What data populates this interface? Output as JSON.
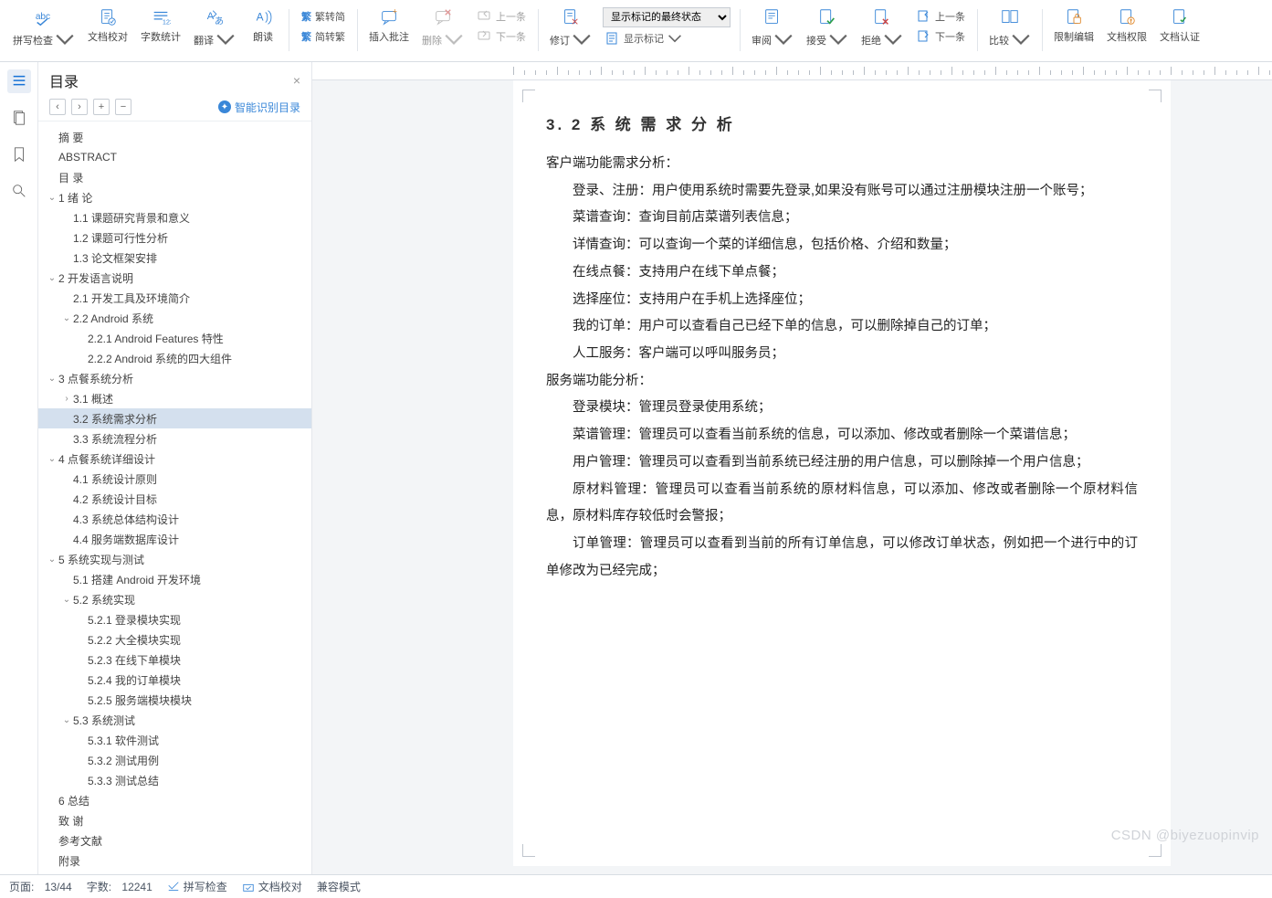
{
  "toolbar": {
    "spellcheck": "拼写检查",
    "proofread": "文档校对",
    "wordcount": "字数统计",
    "translate": "翻译",
    "read": "朗读",
    "fanjian_top": "繁转简",
    "fanjian_bot": "简转繁",
    "fanjian_pre1": "繁",
    "fanjian_pre2": "繁",
    "insert_comment": "插入批注",
    "delete": "删除",
    "prev_comment": "上一条",
    "next_comment": "下一条",
    "revise": "修订",
    "show_markup_label": "显示标记",
    "markup_select": "显示标记的最终状态",
    "review": "审阅",
    "accept": "接受",
    "reject": "拒绝",
    "rev_prev": "上一条",
    "rev_next": "下一条",
    "compare": "比较",
    "restrict": "限制编辑",
    "permission": "文档权限",
    "certify": "文档认证"
  },
  "panel": {
    "title": "目录",
    "close": "×",
    "smart": "智能识别目录",
    "btn_collapse": "‹",
    "btn_expand": "›",
    "btn_add": "+",
    "btn_remove": "−"
  },
  "outline": [
    {
      "d": 1,
      "tw": "",
      "t": "摘  要"
    },
    {
      "d": 1,
      "tw": "",
      "t": "ABSTRACT"
    },
    {
      "d": 1,
      "tw": "",
      "t": "目 录"
    },
    {
      "d": 1,
      "tw": "v",
      "t": "1 绪 论"
    },
    {
      "d": 2,
      "tw": "",
      "t": "1.1 课题研究背景和意义"
    },
    {
      "d": 2,
      "tw": "",
      "t": "1.2 课题可行性分析"
    },
    {
      "d": 2,
      "tw": "",
      "t": "1.3 论文框架安排"
    },
    {
      "d": 1,
      "tw": "v",
      "t": "2 开发语言说明"
    },
    {
      "d": 2,
      "tw": "",
      "t": "2.1 开发工具及环境简介"
    },
    {
      "d": 2,
      "tw": "v",
      "t": "2.2 Android 系统"
    },
    {
      "d": 3,
      "tw": "",
      "t": "2.2.1 Android Features 特性"
    },
    {
      "d": 3,
      "tw": "",
      "t": "2.2.2 Android 系统的四大组件"
    },
    {
      "d": 1,
      "tw": "v",
      "t": "3 点餐系统分析"
    },
    {
      "d": 2,
      "tw": ">",
      "t": "3.1 概述"
    },
    {
      "d": 2,
      "tw": "",
      "t": "3.2 系统需求分析",
      "active": true
    },
    {
      "d": 2,
      "tw": "",
      "t": "3.3 系统流程分析"
    },
    {
      "d": 1,
      "tw": "v",
      "t": "4 点餐系统详细设计"
    },
    {
      "d": 2,
      "tw": "",
      "t": "4.1 系统设计原则"
    },
    {
      "d": 2,
      "tw": "",
      "t": "4.2 系统设计目标"
    },
    {
      "d": 2,
      "tw": "",
      "t": "4.3 系统总体结构设计"
    },
    {
      "d": 2,
      "tw": "",
      "t": "4.4 服务端数据库设计"
    },
    {
      "d": 1,
      "tw": "v",
      "t": "5 系统实现与测试"
    },
    {
      "d": 2,
      "tw": "",
      "t": "5.1 搭建 Android 开发环境"
    },
    {
      "d": 2,
      "tw": "v",
      "t": "5.2 系统实现"
    },
    {
      "d": 3,
      "tw": "",
      "t": "5.2.1 登录模块实现"
    },
    {
      "d": 3,
      "tw": "",
      "t": "5.2.2 大全模块实现"
    },
    {
      "d": 3,
      "tw": "",
      "t": "5.2.3 在线下单模块"
    },
    {
      "d": 3,
      "tw": "",
      "t": "5.2.4 我的订单模块"
    },
    {
      "d": 3,
      "tw": "",
      "t": "5.2.5 服务端模块模块"
    },
    {
      "d": 2,
      "tw": "v",
      "t": "5.3 系统测试"
    },
    {
      "d": 3,
      "tw": "",
      "t": "5.3.1 软件测试"
    },
    {
      "d": 3,
      "tw": "",
      "t": "5.3.2 测试用例"
    },
    {
      "d": 3,
      "tw": "",
      "t": "5.3.3 测试总结"
    },
    {
      "d": 1,
      "tw": "",
      "t": "6 总结"
    },
    {
      "d": 1,
      "tw": "",
      "t": "致 谢"
    },
    {
      "d": 1,
      "tw": "",
      "t": "参考文献"
    },
    {
      "d": 1,
      "tw": "",
      "t": "附录"
    }
  ],
  "doc": {
    "heading": "3. 2 系 统 需 求 分 析",
    "paras": [
      {
        "ind": false,
        "t": "客户端功能需求分析："
      },
      {
        "ind": true,
        "t": "登录、注册：用户使用系统时需要先登录,如果没有账号可以通过注册模块注册一个账号；"
      },
      {
        "ind": true,
        "t": "菜谱查询：查询目前店菜谱列表信息；"
      },
      {
        "ind": true,
        "t": "详情查询：可以查询一个菜的详细信息，包括价格、介绍和数量；"
      },
      {
        "ind": true,
        "t": "在线点餐：支持用户在线下单点餐；"
      },
      {
        "ind": true,
        "t": "选择座位：支持用户在手机上选择座位；"
      },
      {
        "ind": true,
        "t": "我的订单：用户可以查看自己已经下单的信息，可以删除掉自己的订单；"
      },
      {
        "ind": true,
        "t": "人工服务：客户端可以呼叫服务员；"
      },
      {
        "ind": false,
        "t": "服务端功能分析："
      },
      {
        "ind": true,
        "t": "登录模块：管理员登录使用系统；"
      },
      {
        "ind": true,
        "t": "菜谱管理：管理员可以查看当前系统的信息，可以添加、修改或者删除一个菜谱信息；"
      },
      {
        "ind": true,
        "t": "用户管理：管理员可以查看到当前系统已经注册的用户信息，可以删除掉一个用户信息；"
      },
      {
        "ind": true,
        "t": "原材料管理：管理员可以查看当前系统的原材料信息，可以添加、修改或者删除一个原材料信息，原材料库存较低时会警报；"
      },
      {
        "ind": true,
        "t": "订单管理：管理员可以查看到当前的所有订单信息，可以修改订单状态，例如把一个进行中的订单修改为已经完成；"
      }
    ]
  },
  "status": {
    "page_label": "页面:",
    "page_val": "13/44",
    "words_label": "字数:",
    "words_val": "12241",
    "spell": "拼写检查",
    "proof": "文档校对",
    "compat": "兼容模式"
  },
  "watermark": "CSDN @biyezuopinvip",
  "colors": {
    "accent": "#1672d6"
  }
}
